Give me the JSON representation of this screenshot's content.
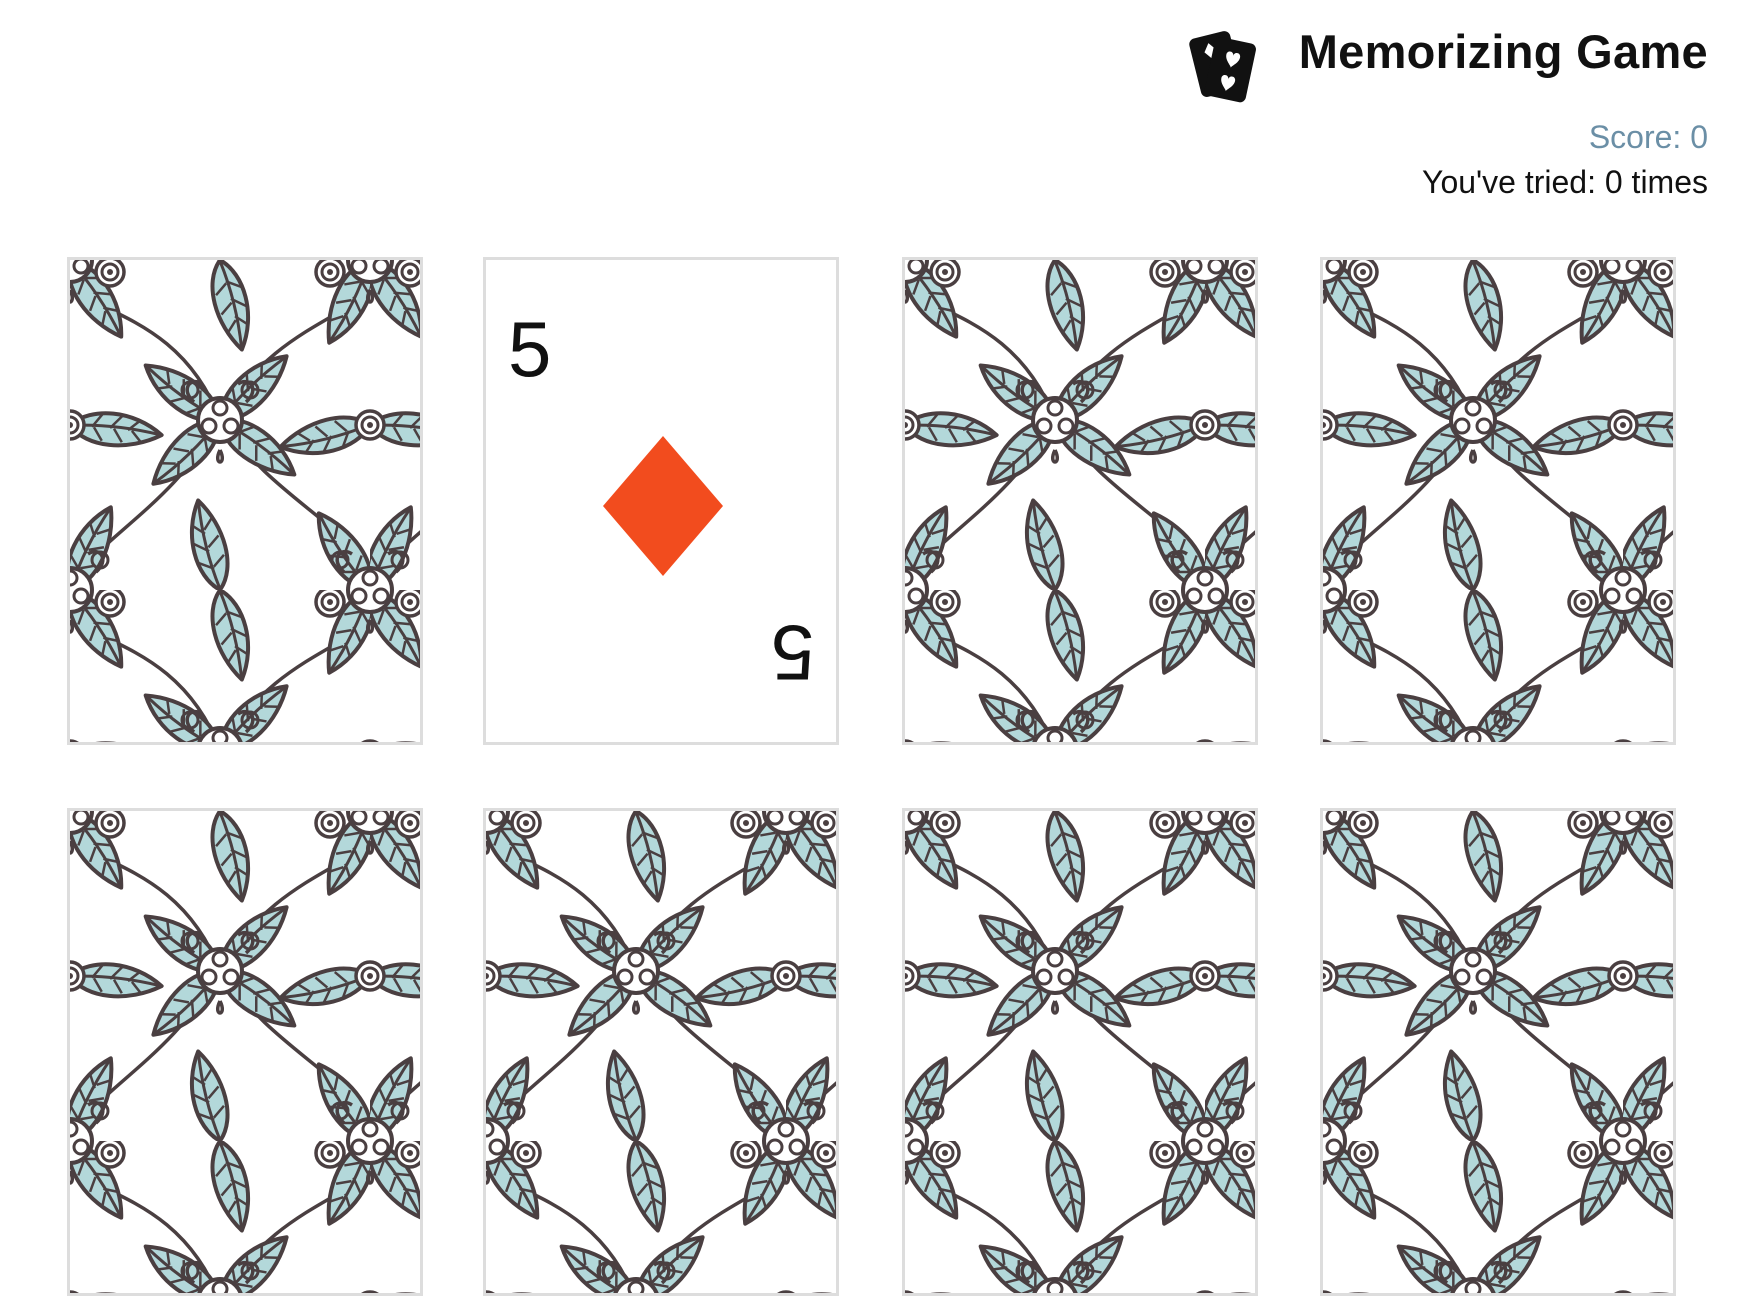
{
  "header": {
    "title": "Memorizing Game",
    "logo_icon": "playing-cards-icon",
    "score": "Score: 0",
    "tries": "You've tried: 0 times"
  },
  "colors": {
    "score_text": "#6b8fa6",
    "suit_diamond": "#f24c1e",
    "leaf_fill": "#b3d8da",
    "pattern_stroke": "#4a3f41",
    "card_border": "#dddddd"
  },
  "cards": [
    {
      "state": "back"
    },
    {
      "state": "face",
      "number": "5",
      "suit": "diamond"
    },
    {
      "state": "back"
    },
    {
      "state": "back"
    },
    {
      "state": "back"
    },
    {
      "state": "back"
    },
    {
      "state": "back"
    },
    {
      "state": "back"
    }
  ]
}
